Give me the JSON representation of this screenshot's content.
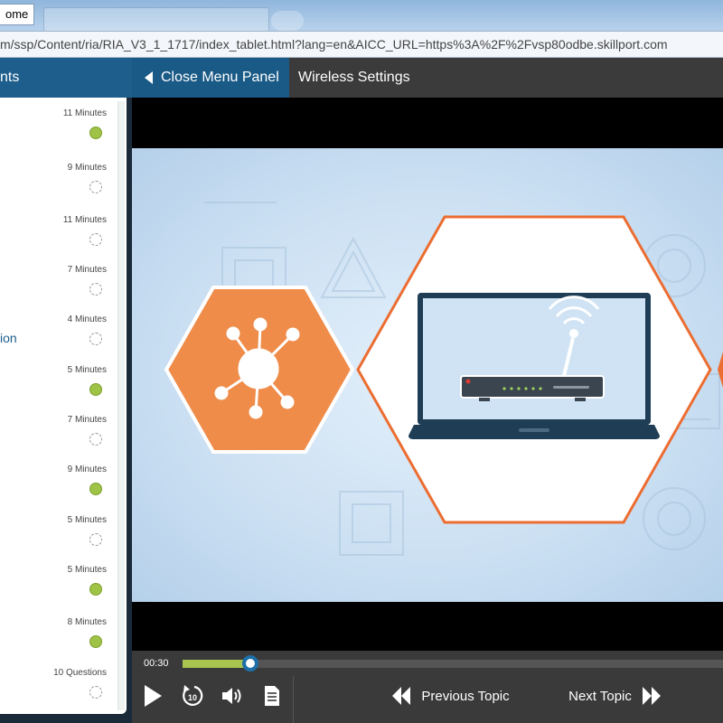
{
  "browser": {
    "tab_title": "ome",
    "url": "m/ssp/Content/ria/RIA_V3_1_1717/index_tablet.html?lang=en&AICC_URL=https%3A%2F%2Fvsp80odbe.skillport.com"
  },
  "header": {
    "menu_label": "nts",
    "close_menu_label": "Close Menu Panel",
    "topic_title": "Wireless Settings"
  },
  "menu": {
    "partial_label": "ion",
    "items": [
      {
        "duration": "11 Minutes",
        "status": "complete"
      },
      {
        "duration": "9 Minutes",
        "status": "incomplete"
      },
      {
        "duration": "11 Minutes",
        "status": "incomplete"
      },
      {
        "duration": "7 Minutes",
        "status": "incomplete"
      },
      {
        "duration": "4 Minutes",
        "status": "incomplete"
      },
      {
        "duration": "5 Minutes",
        "status": "complete"
      },
      {
        "duration": "7 Minutes",
        "status": "incomplete"
      },
      {
        "duration": "9 Minutes",
        "status": "complete"
      },
      {
        "duration": "5 Minutes",
        "status": "incomplete"
      },
      {
        "duration": "5 Minutes",
        "status": "complete"
      },
      {
        "duration": "8 Minutes",
        "status": "complete"
      },
      {
        "duration": "10 Questions",
        "status": "incomplete"
      }
    ]
  },
  "player": {
    "current_time": "00:30",
    "progress_fraction": 0.125,
    "prev_label": "Previous Topic",
    "next_label": "Next Topic",
    "replay_seconds": "10"
  },
  "colors": {
    "accent_blue": "#1d5e8c",
    "complete_green": "#9fc347",
    "slide_orange": "#ec6d31"
  },
  "icons": {
    "play": "play-icon",
    "replay": "replay-10-icon",
    "volume": "volume-icon",
    "transcript": "document-icon",
    "prev": "double-chevron-left-icon",
    "next": "double-chevron-right-icon"
  }
}
